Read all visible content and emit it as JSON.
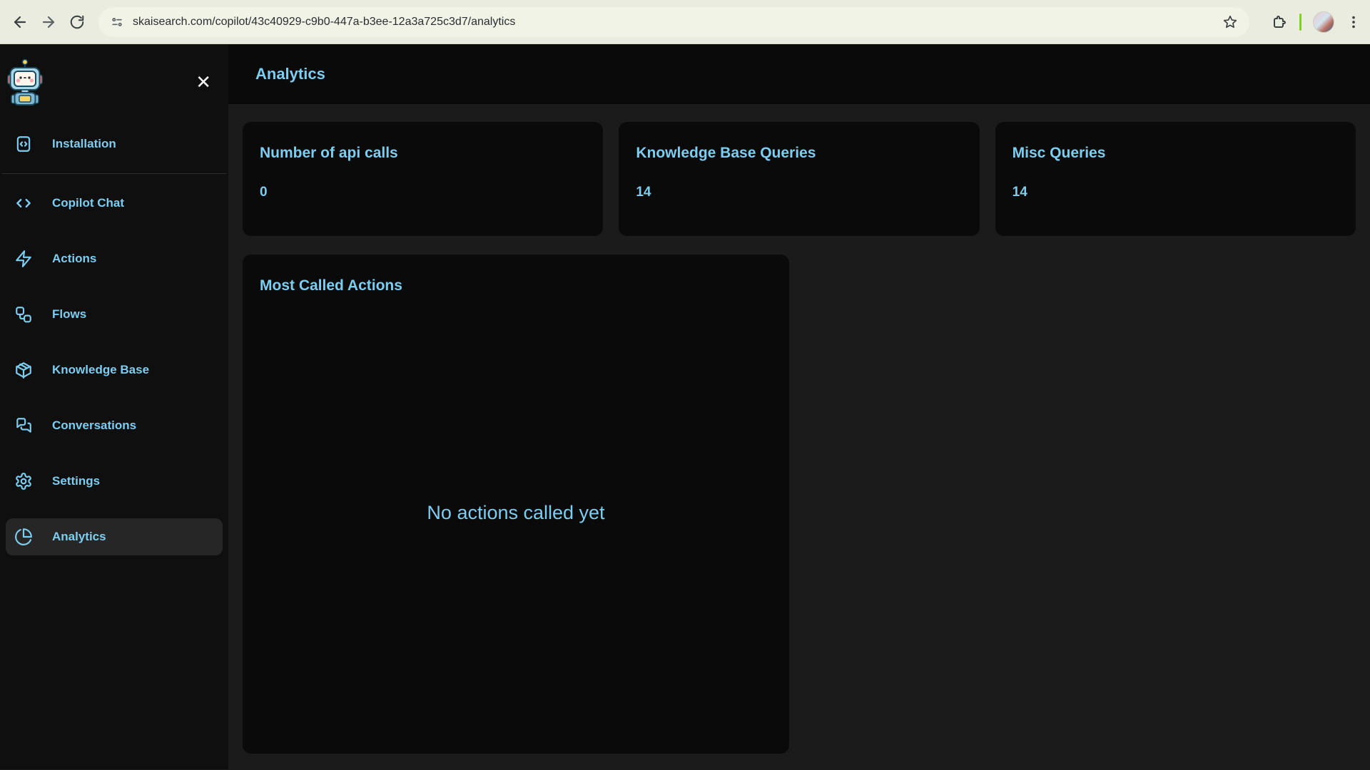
{
  "colors": {
    "accent": "#7dcdf1",
    "divider_green": "#7ed321"
  },
  "browser": {
    "url": "skaisearch.com/copilot/43c40929-c9b0-447a-b3ee-12a3a725c3d7/analytics",
    "back_icon": "back-arrow",
    "forward_icon": "forward-arrow",
    "refresh_icon": "refresh",
    "site_info_icon": "tune",
    "bookmark_icon": "star",
    "extensions_icon": "puzzle",
    "menu_icon": "three-dots-vertical"
  },
  "sidebar": {
    "logo": "robot-mascot",
    "close_label": "✕",
    "items": [
      {
        "label": "Installation",
        "icon": "code-square-icon",
        "active": false
      },
      {
        "label": "Copilot Chat",
        "icon": "code-icon",
        "active": false
      },
      {
        "label": "Actions",
        "icon": "zap-icon",
        "active": false
      },
      {
        "label": "Flows",
        "icon": "workflow-icon",
        "active": false
      },
      {
        "label": "Knowledge Base",
        "icon": "cube-icon",
        "active": false
      },
      {
        "label": "Conversations",
        "icon": "chat-bubbles-icon",
        "active": false
      },
      {
        "label": "Settings",
        "icon": "gear-icon",
        "active": false
      },
      {
        "label": "Analytics",
        "icon": "pie-chart-icon",
        "active": true
      }
    ]
  },
  "header": {
    "title": "Analytics"
  },
  "stats": [
    {
      "title": "Number of api calls",
      "value": "0"
    },
    {
      "title": "Knowledge Base Queries",
      "value": "14"
    },
    {
      "title": "Misc Queries",
      "value": "14"
    }
  ],
  "actions_card": {
    "title": "Most Called Actions",
    "empty_message": "No actions called yet"
  }
}
